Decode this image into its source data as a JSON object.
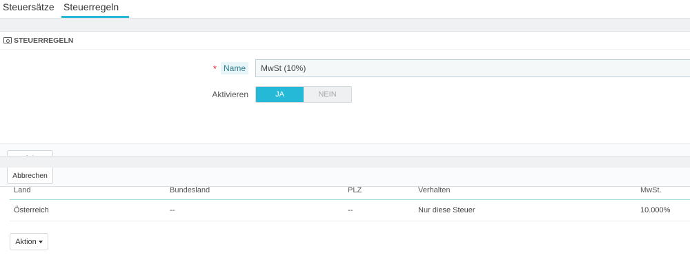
{
  "tabs": [
    {
      "label": "Steuersätze",
      "active": false
    },
    {
      "label": "Steuerregeln",
      "active": true
    }
  ],
  "panel": {
    "heading": "STEUERREGELN",
    "heading_icon": "money-icon",
    "name_label": "Name",
    "required_mark": "*",
    "name_value": "MwSt (10%)",
    "active_label": "Aktivieren",
    "toggle_on": "JA",
    "toggle_off": "NEIN",
    "toggle_selected": "JA",
    "cancel_label": "Abbrechen",
    "cancel_icon": "close-icon"
  },
  "table": {
    "columns": [
      "Land",
      "Bundesland",
      "PLZ",
      "Verhalten",
      "MwSt."
    ],
    "rows": [
      [
        "Österreich",
        "--",
        "--",
        "Nur diese Steuer",
        "10.000%"
      ]
    ]
  },
  "action_button": "Aktion",
  "colors": {
    "accent": "#25b9d7",
    "background_band": "#eff1f2"
  }
}
